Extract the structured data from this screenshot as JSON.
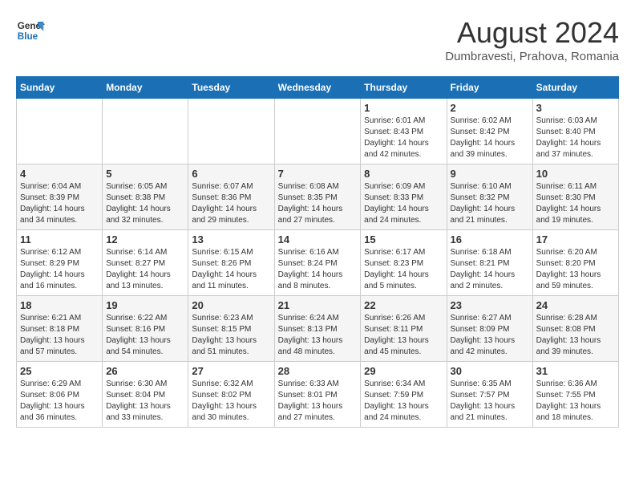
{
  "logo": {
    "line1": "General",
    "line2": "Blue"
  },
  "title": "August 2024",
  "subtitle": "Dumbravesti, Prahova, Romania",
  "weekdays": [
    "Sunday",
    "Monday",
    "Tuesday",
    "Wednesday",
    "Thursday",
    "Friday",
    "Saturday"
  ],
  "weeks": [
    [
      {
        "day": "",
        "info": ""
      },
      {
        "day": "",
        "info": ""
      },
      {
        "day": "",
        "info": ""
      },
      {
        "day": "",
        "info": ""
      },
      {
        "day": "1",
        "info": "Sunrise: 6:01 AM\nSunset: 8:43 PM\nDaylight: 14 hours\nand 42 minutes."
      },
      {
        "day": "2",
        "info": "Sunrise: 6:02 AM\nSunset: 8:42 PM\nDaylight: 14 hours\nand 39 minutes."
      },
      {
        "day": "3",
        "info": "Sunrise: 6:03 AM\nSunset: 8:40 PM\nDaylight: 14 hours\nand 37 minutes."
      }
    ],
    [
      {
        "day": "4",
        "info": "Sunrise: 6:04 AM\nSunset: 8:39 PM\nDaylight: 14 hours\nand 34 minutes."
      },
      {
        "day": "5",
        "info": "Sunrise: 6:05 AM\nSunset: 8:38 PM\nDaylight: 14 hours\nand 32 minutes."
      },
      {
        "day": "6",
        "info": "Sunrise: 6:07 AM\nSunset: 8:36 PM\nDaylight: 14 hours\nand 29 minutes."
      },
      {
        "day": "7",
        "info": "Sunrise: 6:08 AM\nSunset: 8:35 PM\nDaylight: 14 hours\nand 27 minutes."
      },
      {
        "day": "8",
        "info": "Sunrise: 6:09 AM\nSunset: 8:33 PM\nDaylight: 14 hours\nand 24 minutes."
      },
      {
        "day": "9",
        "info": "Sunrise: 6:10 AM\nSunset: 8:32 PM\nDaylight: 14 hours\nand 21 minutes."
      },
      {
        "day": "10",
        "info": "Sunrise: 6:11 AM\nSunset: 8:30 PM\nDaylight: 14 hours\nand 19 minutes."
      }
    ],
    [
      {
        "day": "11",
        "info": "Sunrise: 6:12 AM\nSunset: 8:29 PM\nDaylight: 14 hours\nand 16 minutes."
      },
      {
        "day": "12",
        "info": "Sunrise: 6:14 AM\nSunset: 8:27 PM\nDaylight: 14 hours\nand 13 minutes."
      },
      {
        "day": "13",
        "info": "Sunrise: 6:15 AM\nSunset: 8:26 PM\nDaylight: 14 hours\nand 11 minutes."
      },
      {
        "day": "14",
        "info": "Sunrise: 6:16 AM\nSunset: 8:24 PM\nDaylight: 14 hours\nand 8 minutes."
      },
      {
        "day": "15",
        "info": "Sunrise: 6:17 AM\nSunset: 8:23 PM\nDaylight: 14 hours\nand 5 minutes."
      },
      {
        "day": "16",
        "info": "Sunrise: 6:18 AM\nSunset: 8:21 PM\nDaylight: 14 hours\nand 2 minutes."
      },
      {
        "day": "17",
        "info": "Sunrise: 6:20 AM\nSunset: 8:20 PM\nDaylight: 13 hours\nand 59 minutes."
      }
    ],
    [
      {
        "day": "18",
        "info": "Sunrise: 6:21 AM\nSunset: 8:18 PM\nDaylight: 13 hours\nand 57 minutes."
      },
      {
        "day": "19",
        "info": "Sunrise: 6:22 AM\nSunset: 8:16 PM\nDaylight: 13 hours\nand 54 minutes."
      },
      {
        "day": "20",
        "info": "Sunrise: 6:23 AM\nSunset: 8:15 PM\nDaylight: 13 hours\nand 51 minutes."
      },
      {
        "day": "21",
        "info": "Sunrise: 6:24 AM\nSunset: 8:13 PM\nDaylight: 13 hours\nand 48 minutes."
      },
      {
        "day": "22",
        "info": "Sunrise: 6:26 AM\nSunset: 8:11 PM\nDaylight: 13 hours\nand 45 minutes."
      },
      {
        "day": "23",
        "info": "Sunrise: 6:27 AM\nSunset: 8:09 PM\nDaylight: 13 hours\nand 42 minutes."
      },
      {
        "day": "24",
        "info": "Sunrise: 6:28 AM\nSunset: 8:08 PM\nDaylight: 13 hours\nand 39 minutes."
      }
    ],
    [
      {
        "day": "25",
        "info": "Sunrise: 6:29 AM\nSunset: 8:06 PM\nDaylight: 13 hours\nand 36 minutes."
      },
      {
        "day": "26",
        "info": "Sunrise: 6:30 AM\nSunset: 8:04 PM\nDaylight: 13 hours\nand 33 minutes."
      },
      {
        "day": "27",
        "info": "Sunrise: 6:32 AM\nSunset: 8:02 PM\nDaylight: 13 hours\nand 30 minutes."
      },
      {
        "day": "28",
        "info": "Sunrise: 6:33 AM\nSunset: 8:01 PM\nDaylight: 13 hours\nand 27 minutes."
      },
      {
        "day": "29",
        "info": "Sunrise: 6:34 AM\nSunset: 7:59 PM\nDaylight: 13 hours\nand 24 minutes."
      },
      {
        "day": "30",
        "info": "Sunrise: 6:35 AM\nSunset: 7:57 PM\nDaylight: 13 hours\nand 21 minutes."
      },
      {
        "day": "31",
        "info": "Sunrise: 6:36 AM\nSunset: 7:55 PM\nDaylight: 13 hours\nand 18 minutes."
      }
    ]
  ]
}
